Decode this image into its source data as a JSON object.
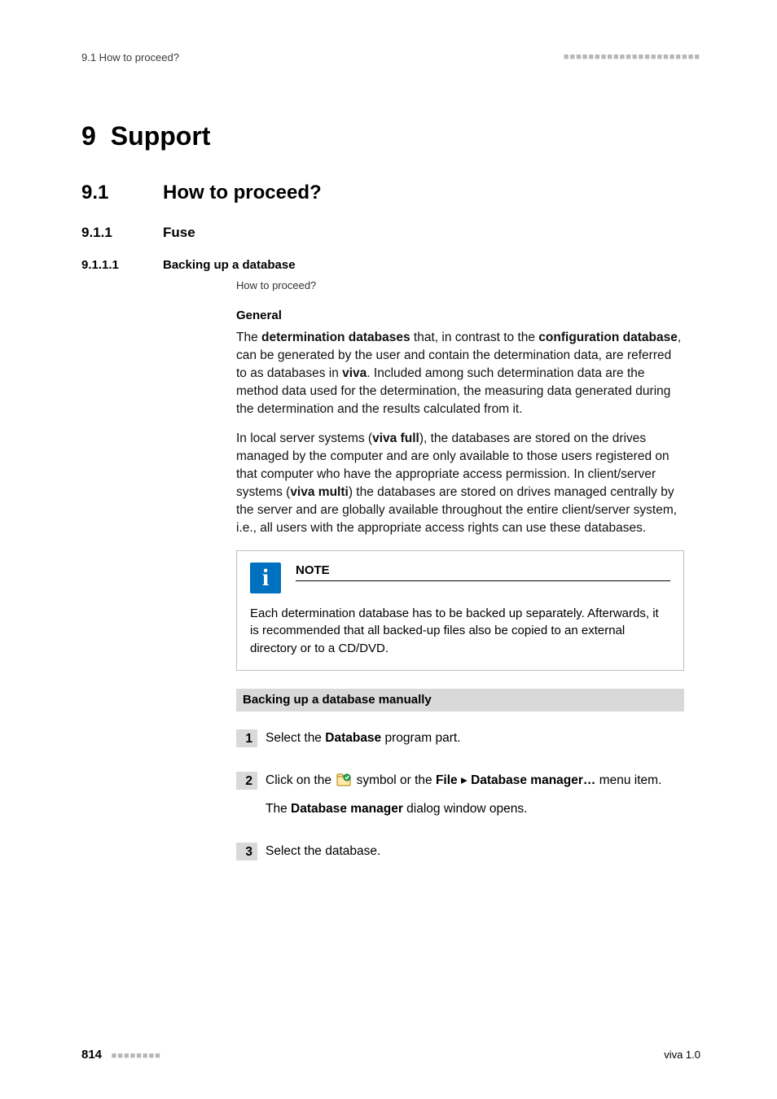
{
  "header": {
    "running": "9.1 How to proceed?"
  },
  "chapter": {
    "num": "9",
    "title": "Support"
  },
  "sec91": {
    "num": "9.1",
    "title": "How to proceed?"
  },
  "sec911": {
    "num": "9.1.1",
    "title": "Fuse"
  },
  "sec9111": {
    "num": "9.1.1.1",
    "title": "Backing up a database"
  },
  "howto": "How to proceed?",
  "general_head": "General",
  "para1": {
    "a": "The ",
    "b": "determination databases",
    "c": " that, in contrast to the ",
    "d": "configuration database",
    "e": ", can be generated by the user and contain the determination data, are referred to as databases in ",
    "f": "viva",
    "g": ". Included among such determination data are the method data used for the determination, the measuring data generated during the determination and the results calculated from it."
  },
  "para2": {
    "a": "In local server systems (",
    "b": "viva full",
    "c": "), the databases are stored on the drives managed by the computer and are only available to those users registered on that computer who have the appropriate access permission. In client/server systems (",
    "d": "viva multi",
    "e": ") the databases are stored on drives managed centrally by the server and are globally available throughout the entire client/server system, i.e., all users with the appropriate access rights can use these databases."
  },
  "note": {
    "title": "NOTE",
    "text": "Each determination database has to be backed up separately. Afterwards, it is recommended that all backed-up files also be copied to an external directory or to a CD/DVD."
  },
  "task_title": "Backing up a database manually",
  "steps": {
    "s1": {
      "n": "1",
      "a": "Select the ",
      "b": "Database",
      "c": " program part."
    },
    "s2": {
      "n": "2",
      "a": "Click on the ",
      "b": " symbol or the ",
      "c": "File",
      "d": " ▸ ",
      "e": "Database manager…",
      "f": " menu item.",
      "g": "The ",
      "h": "Database manager",
      "i": " dialog window opens."
    },
    "s3": {
      "n": "3",
      "a": "Select the database."
    }
  },
  "footer": {
    "page": "814",
    "product": "viva 1.0"
  }
}
